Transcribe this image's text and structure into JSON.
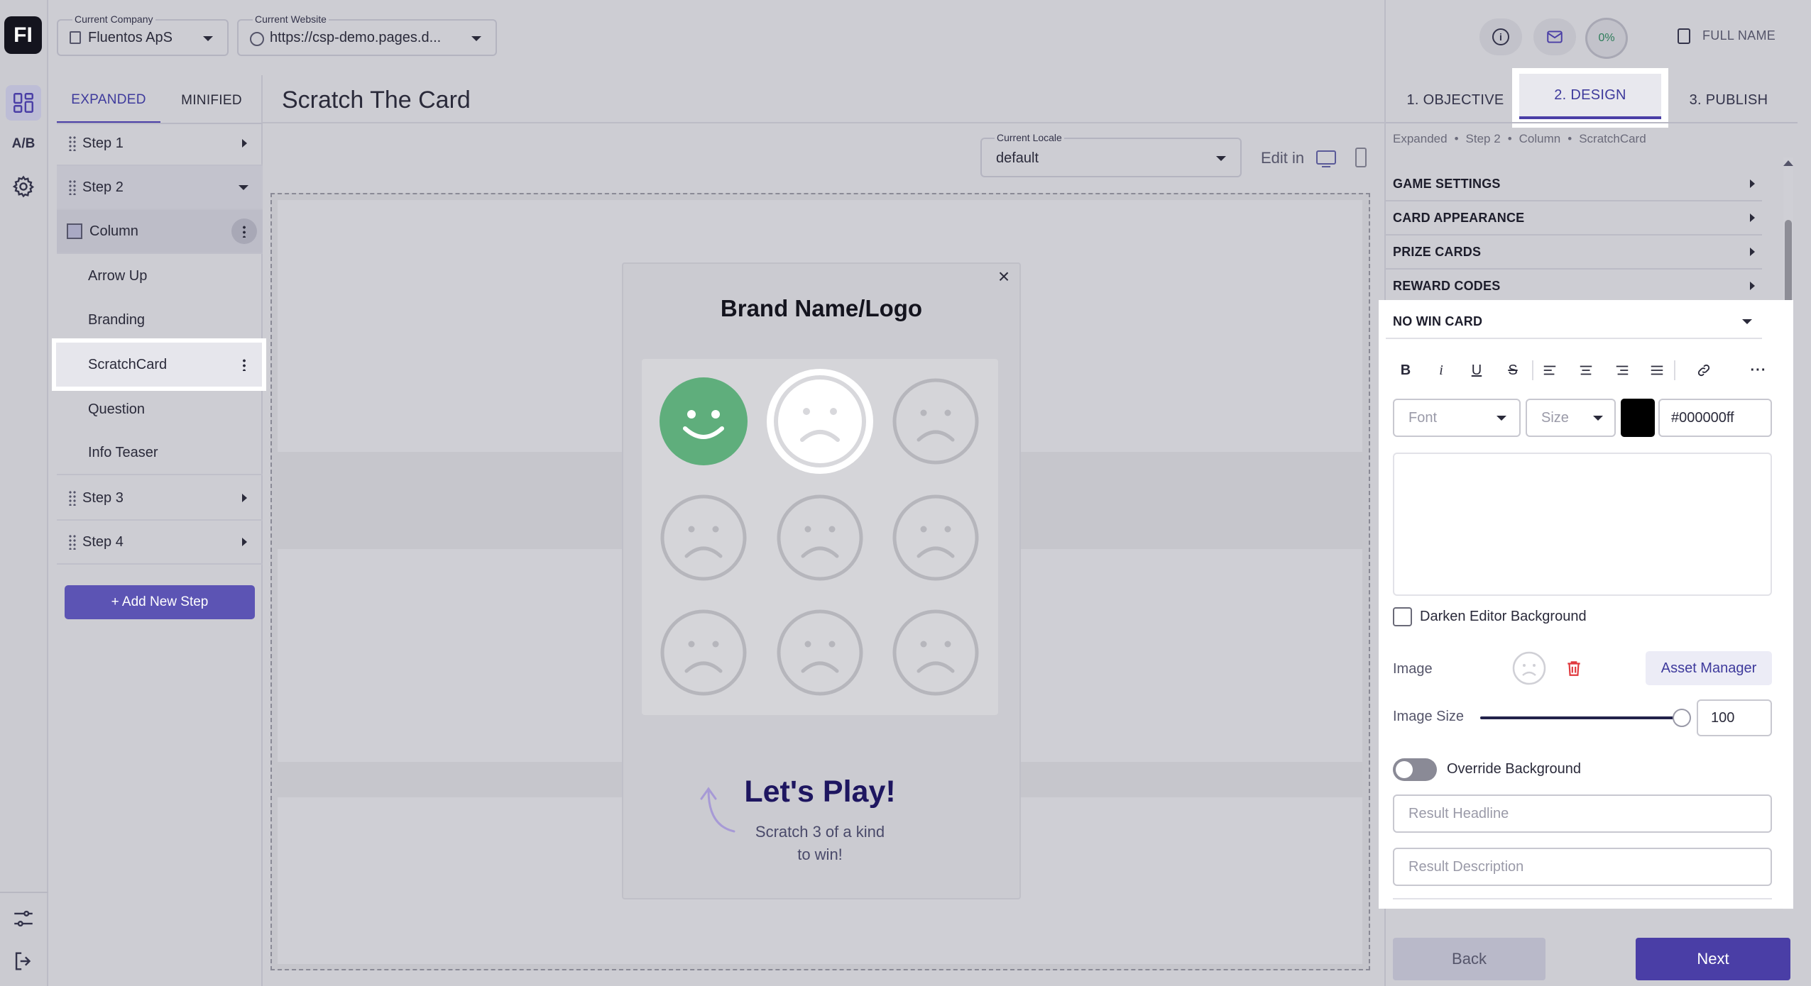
{
  "topbar": {
    "company_label": "Current Company",
    "company_value": "Fluentos ApS",
    "website_label": "Current Website",
    "website_value": "https://csp-demo.pages.d...",
    "progress": "0%",
    "user_name": "FULL NAME"
  },
  "rail": {
    "logo": "FI",
    "ab": "A/B"
  },
  "left_panel": {
    "tabs": [
      "EXPANDED",
      "MINIFIED"
    ],
    "steps": [
      {
        "label": "Step 1"
      },
      {
        "label": "Step 2"
      },
      {
        "label": "Step 3"
      },
      {
        "label": "Step 4"
      }
    ],
    "column_label": "Column",
    "children": [
      "Arrow Up",
      "Branding",
      "ScratchCard",
      "Question",
      "Info Teaser"
    ],
    "add_step": "+ Add New Step"
  },
  "canvas": {
    "title": "Scratch The Card",
    "locale_label": "Current Locale",
    "locale_value": "default",
    "edit_in": "Edit in",
    "card": {
      "brand": "Brand Name/Logo",
      "close": "×",
      "headline": "Let's Play!",
      "subtitle_line1": "Scratch 3 of a kind",
      "subtitle_line2": "to win!"
    }
  },
  "right_panel": {
    "tabs": [
      "1. OBJECTIVE",
      "2. DESIGN",
      "3. PUBLISH"
    ],
    "breadcrumb": [
      "Expanded",
      "Step 2",
      "Column",
      "ScratchCard"
    ],
    "sections": [
      "GAME SETTINGS",
      "CARD APPEARANCE",
      "PRIZE CARDS",
      "REWARD CODES",
      "NO WIN CARD"
    ],
    "font_placeholder": "Font",
    "size_placeholder": "Size",
    "color_value": "#000000ff",
    "color_swatch": "#000000",
    "darken_label": "Darken Editor Background",
    "image_label": "Image",
    "asset_manager": "Asset Manager",
    "image_size_label": "Image Size",
    "image_size_value": "100",
    "image_size_level": 1.0,
    "override_label": "Override Background",
    "result_headline_placeholder": "Result Headline",
    "result_description_placeholder": "Result Description",
    "back": "Back",
    "next": "Next"
  },
  "colors": {
    "accent": "#4a3ea6",
    "accent_text": "#3e3a9c",
    "delete": "#e0393e",
    "green_face": "#5fae7c",
    "headline": "#1e1660"
  }
}
